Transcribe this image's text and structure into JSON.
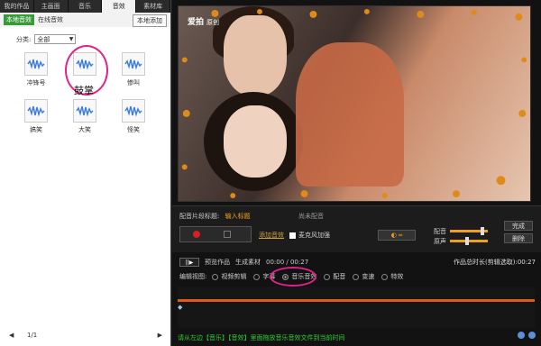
{
  "left_panel": {
    "tabs": [
      "我的作品",
      "主画面",
      "音乐",
      "音效",
      "素材库"
    ],
    "active_tab": "音效",
    "sub_tabs": [
      "本地音效",
      "在线音效"
    ],
    "local_add_label": "本地添加",
    "category_label": "分类:",
    "category_value": "全部",
    "effects": [
      "冲锋号",
      "鼓掌",
      "惨叫",
      "搞笑",
      "大笑",
      "怪笑"
    ],
    "highlight_label": "鼓掌",
    "pager_text": "1/1"
  },
  "video": {
    "logo": "爱拍",
    "logo_sub": "原创"
  },
  "dub": {
    "title_label": "配音片段标题:",
    "title_input": "输入标题",
    "status": "尚未配音",
    "add_effect_label": "添加音效",
    "mic_label": "麦克风加强",
    "toggle_label": "◐ ═",
    "volume_label": "配音",
    "original_label": "原声",
    "volume_level": 0.9,
    "original_level": 0.45,
    "done_label": "完成",
    "delete_label": "删除"
  },
  "transport": {
    "pause_label": "||▶",
    "preview_label": "预览作品",
    "gen_label": "生成素材",
    "time_text": "00:00 / 00:27",
    "total_label": "作品总时长(剪辑选取):00:27"
  },
  "edit_view": {
    "label": "编辑视图:",
    "modes": [
      "视频剪辑",
      "字幕",
      "音乐音效",
      "配音",
      "变速",
      "特效"
    ],
    "selected": "音乐音效"
  },
  "hint": "请从左边【音乐】【音效】里面拖放音乐音效文件到当前时间",
  "colors": {
    "accent_orange": "#e05a1e",
    "highlight_pink": "#e0228a",
    "hint_green": "#2fd02f",
    "chip_green": "#3a9a3a"
  }
}
